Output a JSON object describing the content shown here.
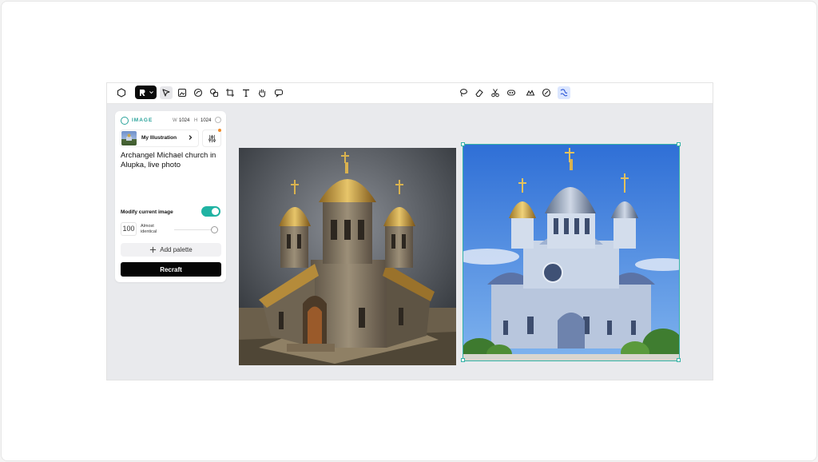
{
  "toolbar": {
    "left_tools": [
      {
        "icon": "hexagon-icon"
      },
      {
        "icon": "model-logo-icon"
      },
      {
        "icon": "select-cursor-icon"
      },
      {
        "icon": "image-frame-icon"
      },
      {
        "icon": "vector-icon"
      },
      {
        "icon": "shapes-icon"
      },
      {
        "icon": "crop-frame-icon"
      },
      {
        "icon": "text-tool-icon"
      },
      {
        "icon": "hand-pan-icon"
      },
      {
        "icon": "comment-icon"
      }
    ],
    "right_tools": [
      {
        "icon": "lasso-icon"
      },
      {
        "icon": "eraser-icon"
      },
      {
        "icon": "scissors-icon"
      },
      {
        "icon": "mask-icon"
      },
      {
        "icon": "upscale-icon"
      },
      {
        "icon": "brush-icon"
      },
      {
        "icon": "variations-icon"
      }
    ],
    "accent_color": "#2a55d6"
  },
  "panel": {
    "type_label": "IMAGE",
    "width_label": "W",
    "width_value": "1024",
    "height_label": "H",
    "height_value": "1024",
    "style_name": "My Illustration",
    "prompt": "Archangel Michael church in Alupka, live photo",
    "modify_label": "Modify current image",
    "modify_enabled": true,
    "strength_value": "100",
    "strength_label": "Almost identical",
    "add_palette_label": "Add palette",
    "recraft_label": "Recraft",
    "accent_color": "#20b3a3"
  },
  "canvas": {
    "images": [
      {
        "name": "original-church-image",
        "description_icon": "church-image"
      },
      {
        "name": "recrafted-church-image",
        "description_icon": "church-image"
      }
    ],
    "selection_color": "#35b3a7"
  }
}
